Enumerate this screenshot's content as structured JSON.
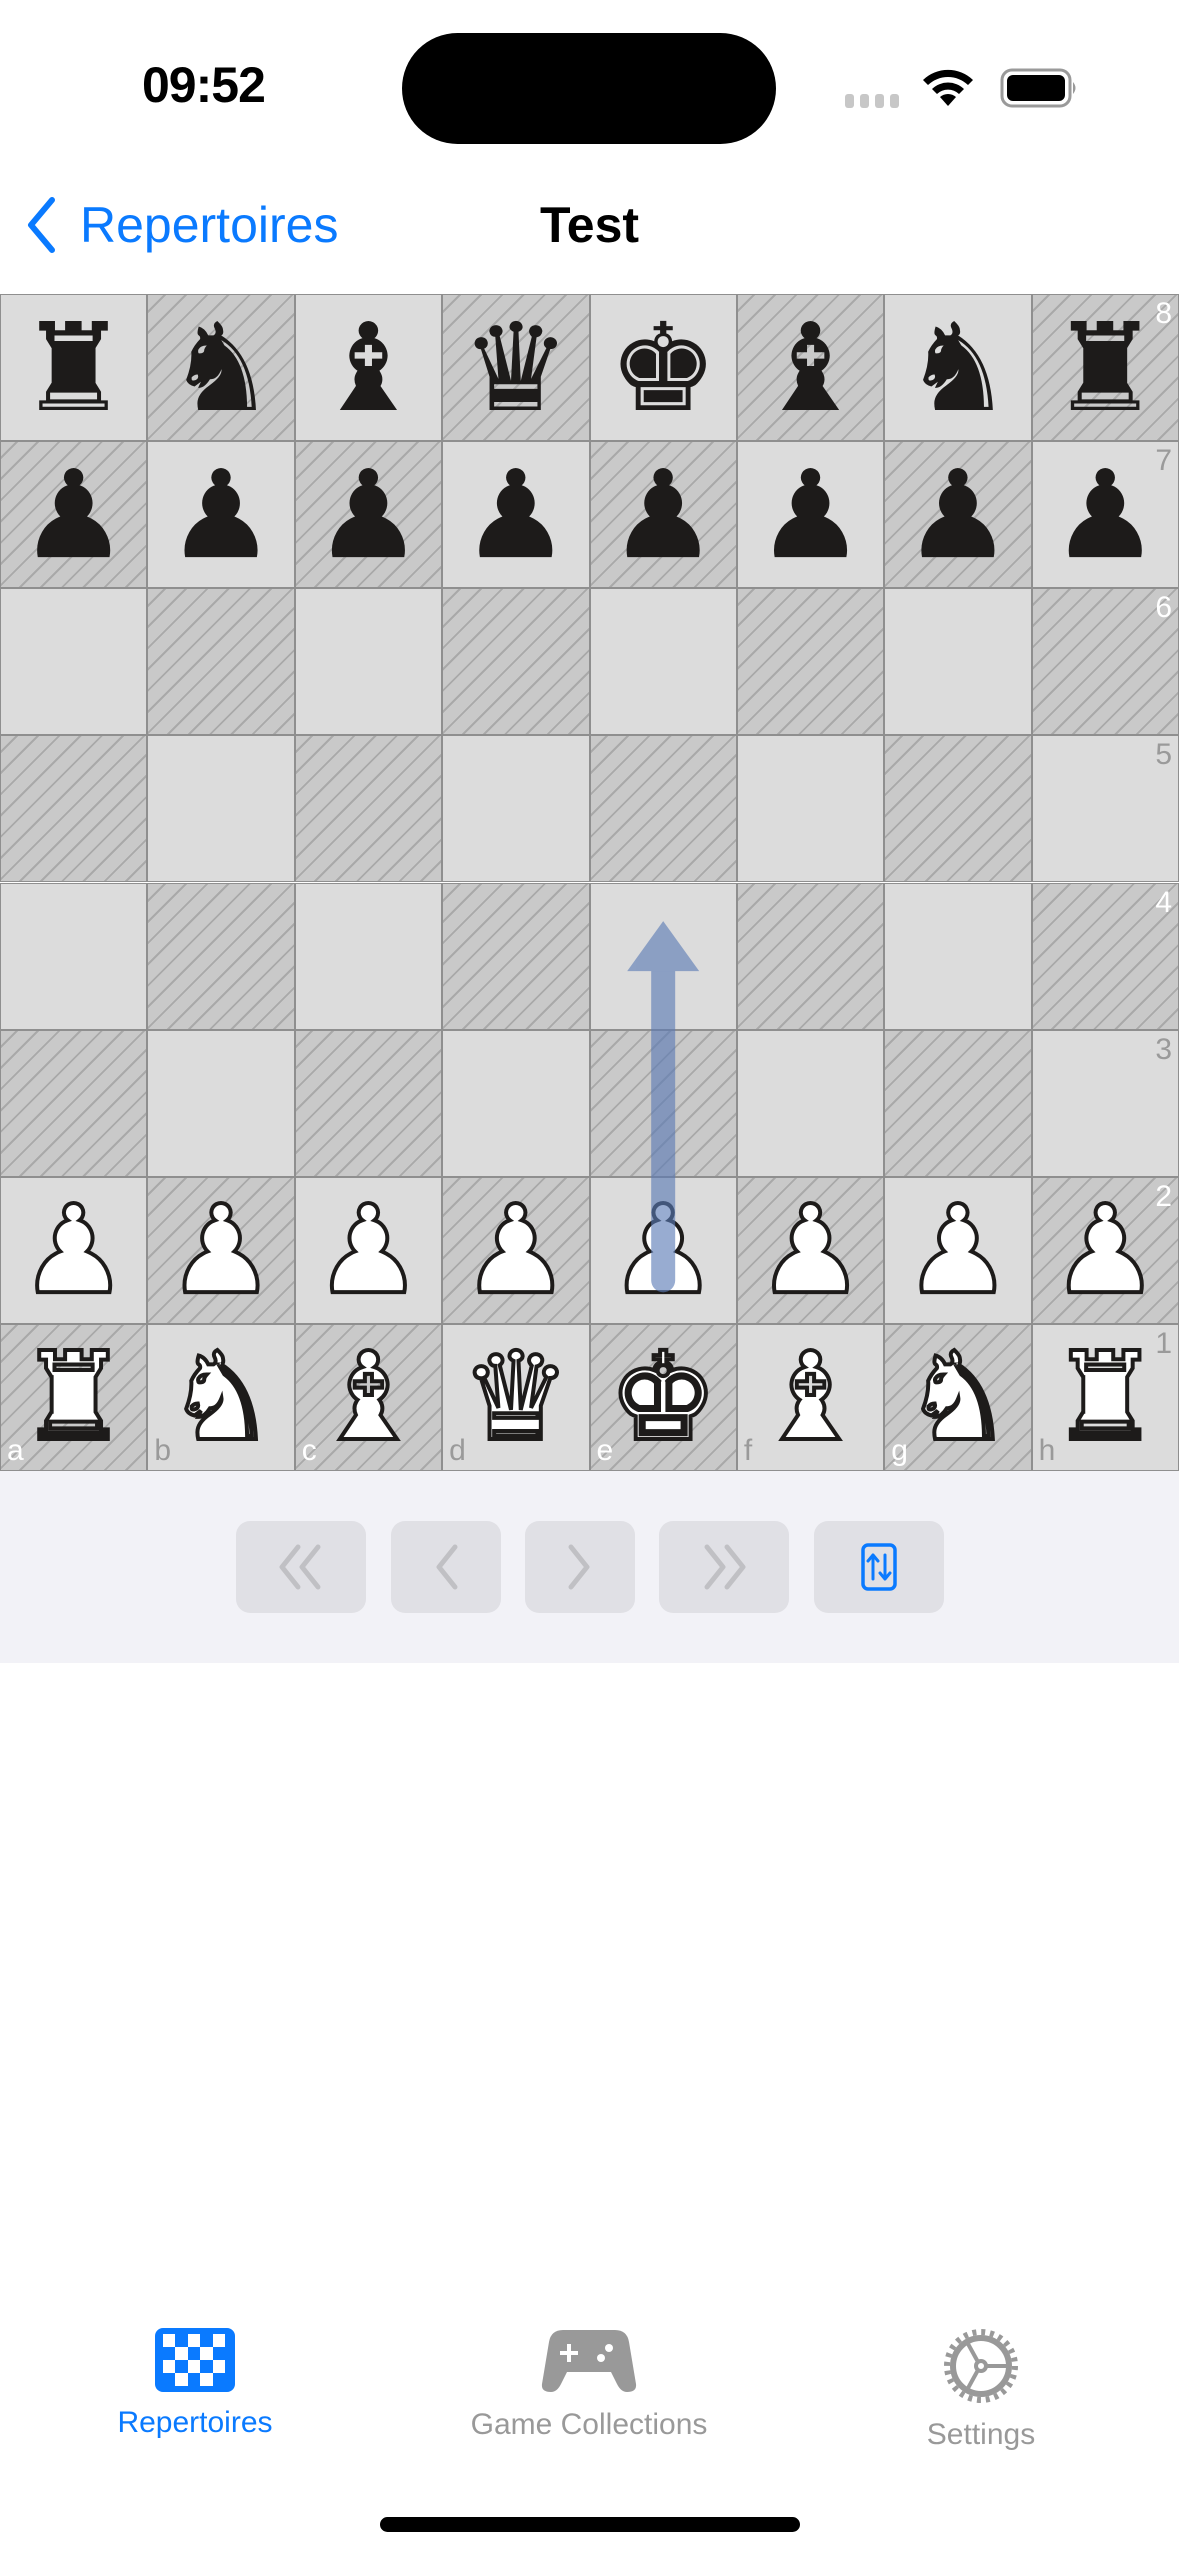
{
  "status_bar": {
    "time": "09:52"
  },
  "nav": {
    "back_label": "Repertoires",
    "title": "Test"
  },
  "board": {
    "orientation": "white",
    "files": [
      "a",
      "b",
      "c",
      "d",
      "e",
      "f",
      "g",
      "h"
    ],
    "ranks": [
      "8",
      "7",
      "6",
      "5",
      "4",
      "3",
      "2",
      "1"
    ],
    "position": [
      [
        "r",
        "n",
        "b",
        "q",
        "k",
        "b",
        "n",
        "r"
      ],
      [
        "p",
        "p",
        "p",
        "p",
        "p",
        "p",
        "p",
        "p"
      ],
      [
        "",
        "",
        "",
        "",
        "",
        "",
        "",
        ""
      ],
      [
        "",
        "",
        "",
        "",
        "",
        "",
        "",
        ""
      ],
      [
        "",
        "",
        "",
        "",
        "",
        "",
        "",
        ""
      ],
      [
        "",
        "",
        "",
        "",
        "",
        "",
        "",
        ""
      ],
      [
        "P",
        "P",
        "P",
        "P",
        "P",
        "P",
        "P",
        "P"
      ],
      [
        "R",
        "N",
        "B",
        "Q",
        "K",
        "B",
        "N",
        "R"
      ]
    ],
    "arrow": {
      "from": "e2",
      "to": "e4",
      "color": "#5a7ab5"
    }
  },
  "controls": {
    "buttons": [
      {
        "name": "first-move-button",
        "icon": "double-chevron-left-icon",
        "enabled": false
      },
      {
        "name": "previous-move-button",
        "icon": "chevron-left-icon",
        "enabled": false
      },
      {
        "name": "next-move-button",
        "icon": "chevron-right-icon",
        "enabled": false
      },
      {
        "name": "last-move-button",
        "icon": "double-chevron-right-icon",
        "enabled": false
      },
      {
        "name": "flip-board-button",
        "icon": "flip-board-icon",
        "enabled": true
      }
    ]
  },
  "tab_bar": {
    "tabs": [
      {
        "label": "Repertoires",
        "icon": "checkerboard-icon",
        "active": true
      },
      {
        "label": "Game Collections",
        "icon": "gamecontroller-icon",
        "active": false
      },
      {
        "label": "Settings",
        "icon": "gear-icon",
        "active": false
      }
    ]
  },
  "colors": {
    "accent": "#0a7aff",
    "inactive": "#999999",
    "disabled_icon": "#c0c0c4"
  }
}
